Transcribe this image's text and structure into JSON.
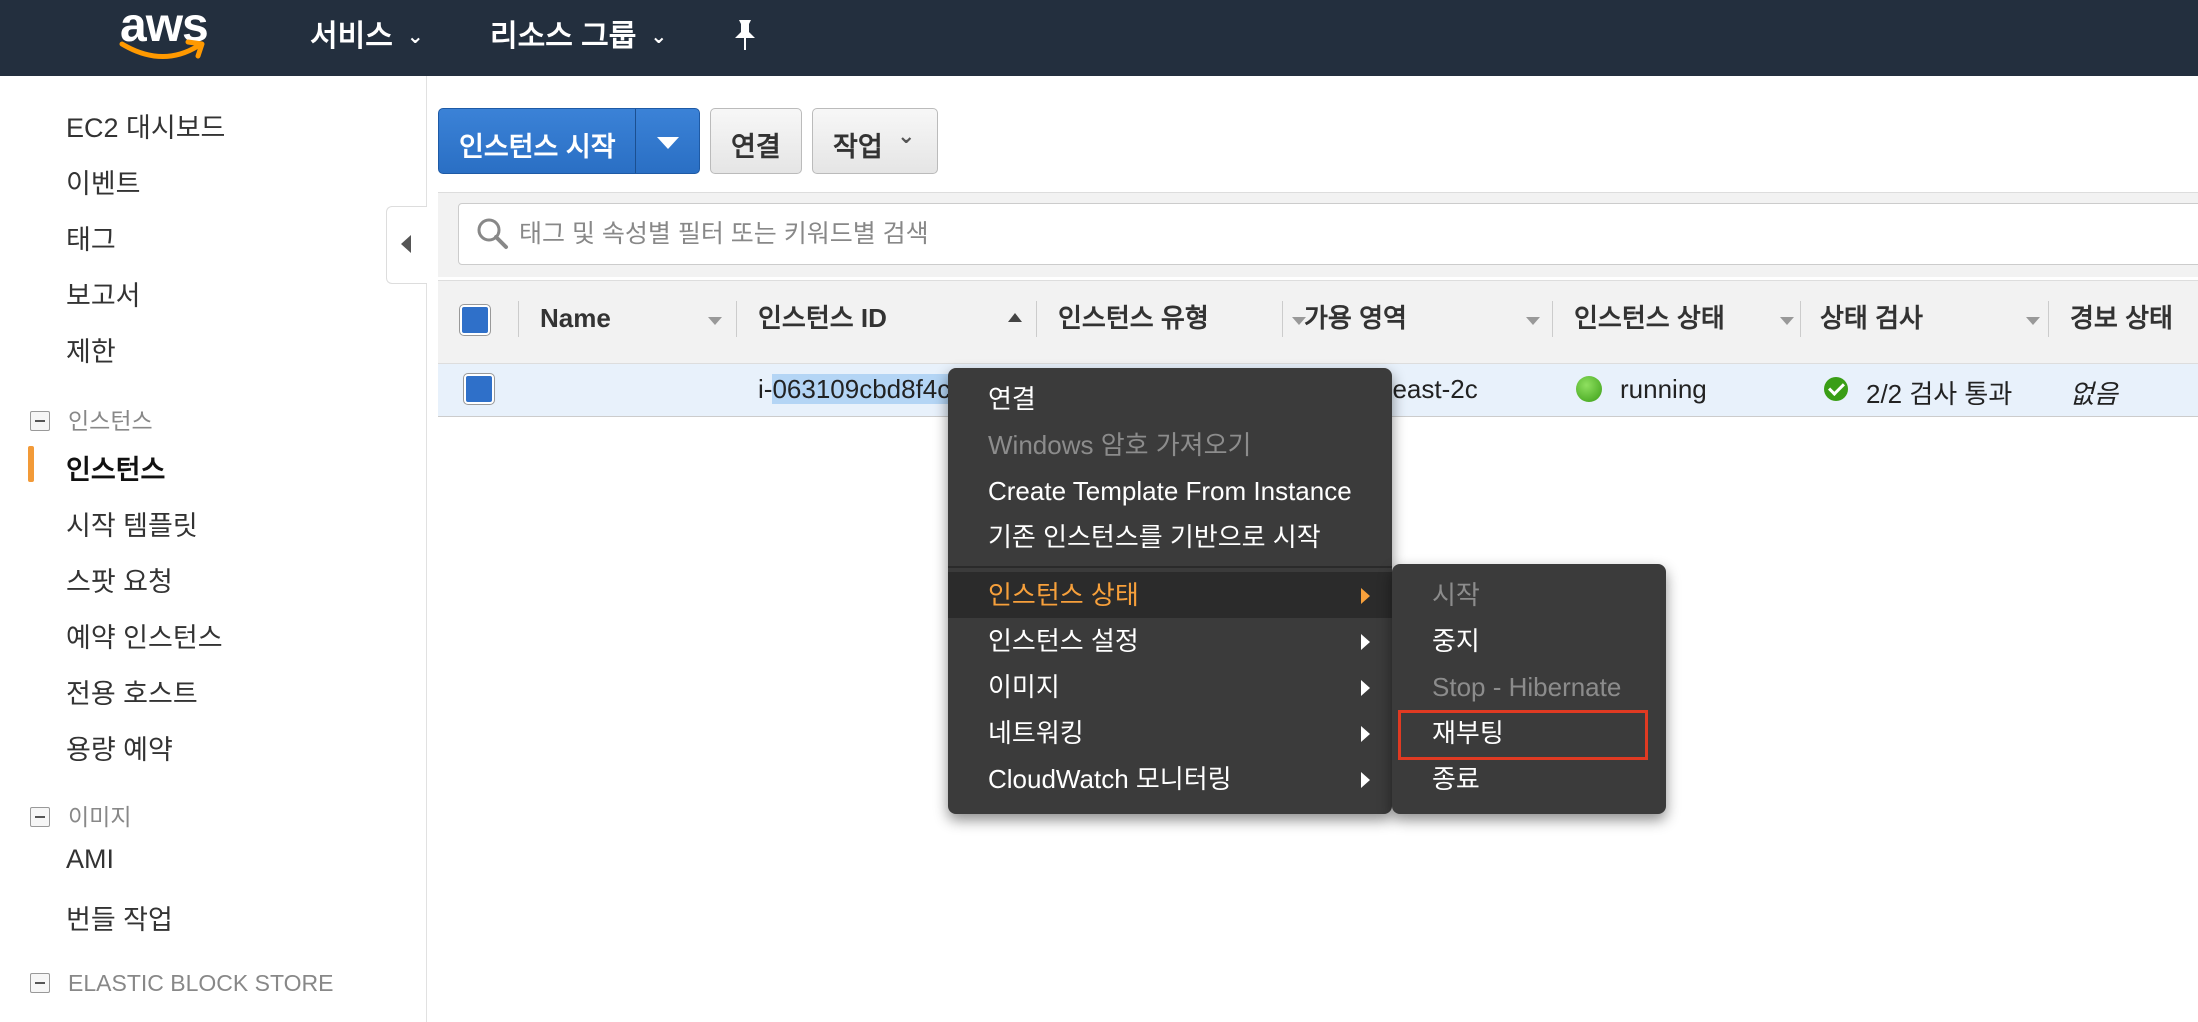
{
  "nav": {
    "logo": "aws",
    "services": "서비스",
    "resource_groups": "리소스 그룹",
    "pin_icon": "pushpin-icon"
  },
  "sidebar": {
    "items_top": [
      "EC2 대시보드",
      "이벤트",
      "태그",
      "보고서",
      "제한"
    ],
    "section_instances": "인스턴스",
    "instances_items": [
      "인스턴스",
      "시작 템플릿",
      "스팟 요청",
      "예약 인스턴스",
      "전용 호스트",
      "용량 예약"
    ],
    "section_images": "이미지",
    "images_items": [
      "AMI",
      "번들 작업"
    ],
    "section_ebs": "ELASTIC BLOCK STORE",
    "active_item": "인스턴스"
  },
  "toolbar": {
    "launch_label": "인스턴스 시작",
    "connect_label": "연결",
    "actions_label": "작업"
  },
  "search": {
    "placeholder": "태그 및 속성별 필터 또는 키워드별 검색"
  },
  "table": {
    "columns": [
      "Name",
      "인스턴스 ID",
      "인스턴스 유형",
      "가용 영역",
      "인스턴스 상태",
      "상태 검사",
      "경보 상태"
    ],
    "rows": [
      {
        "name": "",
        "instance_id_prefix": "i-",
        "instance_id_selected": "063109cbd8f4c",
        "availability_zone": "heast-2c",
        "state": "running",
        "status_check": "2/2 검사 통과",
        "alarm": "없음"
      }
    ]
  },
  "context_menu": {
    "items": [
      {
        "label": "연결",
        "disabled": false
      },
      {
        "label": "Windows 암호 가져오기",
        "disabled": true
      },
      {
        "label": "Create Template From Instance",
        "disabled": false
      },
      {
        "label": "기존 인스턴스를 기반으로 시작",
        "disabled": false
      },
      {
        "label": "인스턴스 상태",
        "submenu": true,
        "hover": true
      },
      {
        "label": "인스턴스 설정",
        "submenu": true
      },
      {
        "label": "이미지",
        "submenu": true
      },
      {
        "label": "네트워킹",
        "submenu": true
      },
      {
        "label": "CloudWatch 모니터링",
        "submenu": true
      }
    ]
  },
  "submenu": {
    "items": [
      {
        "label": "시작",
        "disabled": true
      },
      {
        "label": "중지",
        "disabled": false
      },
      {
        "label": "Stop - Hibernate",
        "disabled": true
      },
      {
        "label": "재부팅",
        "disabled": false,
        "highlighted": true
      },
      {
        "label": "종료",
        "disabled": false
      }
    ]
  },
  "colors": {
    "nav_bg": "#232f3e",
    "primary": "#2a6fc4",
    "accent": "#f29a38",
    "menu_bg": "#3b3b3b",
    "highlight_border": "#e03a22"
  }
}
